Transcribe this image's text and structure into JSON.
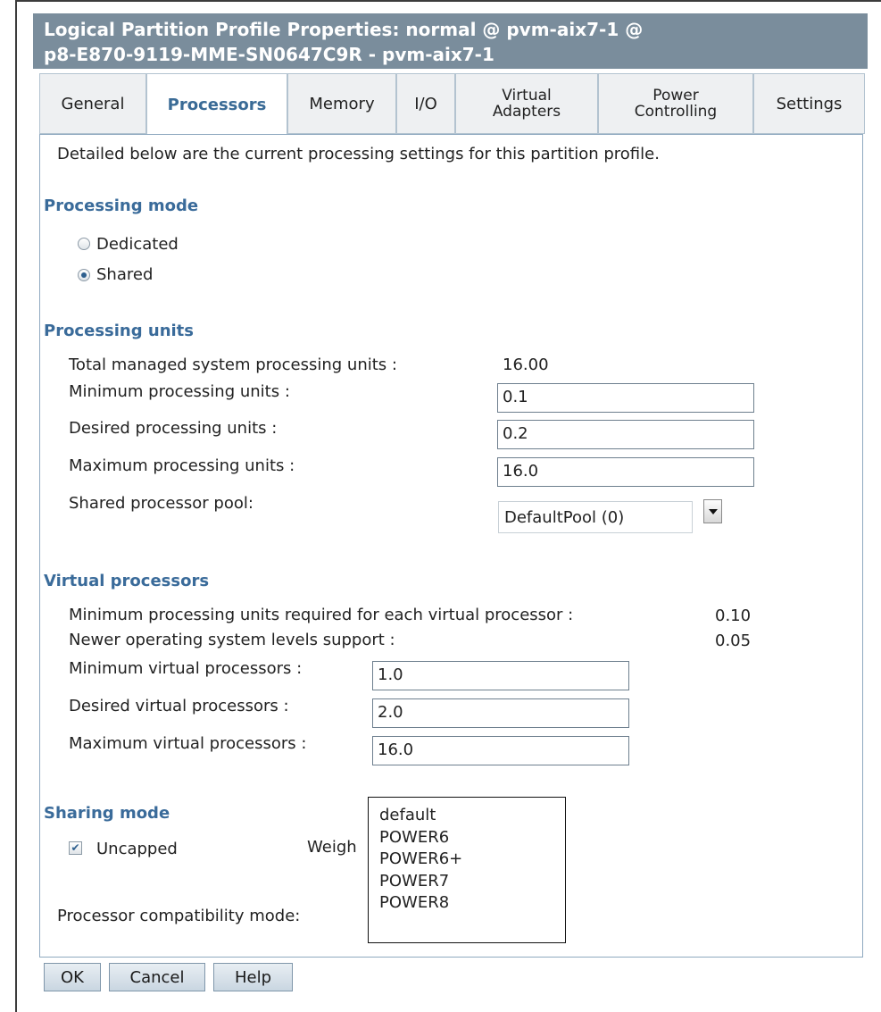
{
  "window": {
    "title_line1": "Logical Partition Profile Properties: normal @ pvm-aix7-1 @",
    "title_line2": "p8-E870-9119-MME-SN0647C9R - pvm-aix7-1"
  },
  "tabs": [
    {
      "label": "General"
    },
    {
      "label_line1": "Processors",
      "active": true
    },
    {
      "label": "Memory"
    },
    {
      "label": "I/O"
    },
    {
      "label_line1": "Virtual",
      "label_line2": "Adapters"
    },
    {
      "label_line1": "Power",
      "label_line2": "Controlling"
    },
    {
      "label": "Settings"
    }
  ],
  "intro": "Detailed below are the current processing settings for this partition profile.",
  "processing_mode": {
    "heading": "Processing mode",
    "options": [
      {
        "label": "Dedicated",
        "selected": false
      },
      {
        "label": "Shared",
        "selected": true
      }
    ]
  },
  "processing_units": {
    "heading": "Processing units",
    "total_label": "Total managed system processing units :",
    "total_value": "16.00",
    "minimum_label": "Minimum processing units :",
    "minimum_value": "0.1",
    "desired_label": "Desired processing units :",
    "desired_value": "0.2",
    "maximum_label": "Maximum processing units :",
    "maximum_value": "16.0",
    "pool_label": "Shared processor pool:",
    "pool_value": "DefaultPool (0)"
  },
  "virtual_processors": {
    "heading": "Virtual processors",
    "min_units_label": "Minimum processing units required for each virtual processor :",
    "min_units_value": "0.10",
    "newer_os_label": "Newer operating system levels support :",
    "newer_os_value": "0.05",
    "minimum_label": "Minimum virtual processors :",
    "minimum_value": "1.0",
    "desired_label": "Desired virtual processors :",
    "desired_value": "2.0",
    "maximum_label": "Maximum virtual processors :",
    "maximum_value": "16.0"
  },
  "sharing_mode": {
    "heading": "Sharing mode",
    "uncapped_label": "Uncapped",
    "uncapped_checked": true,
    "weight_label_visible": "Weigh"
  },
  "compatibility": {
    "label": "Processor compatibility mode:",
    "options": [
      "default",
      "POWER6",
      "POWER6+",
      "POWER7",
      "POWER8"
    ]
  },
  "buttons": {
    "ok": "OK",
    "cancel": "Cancel",
    "help": "Help"
  }
}
